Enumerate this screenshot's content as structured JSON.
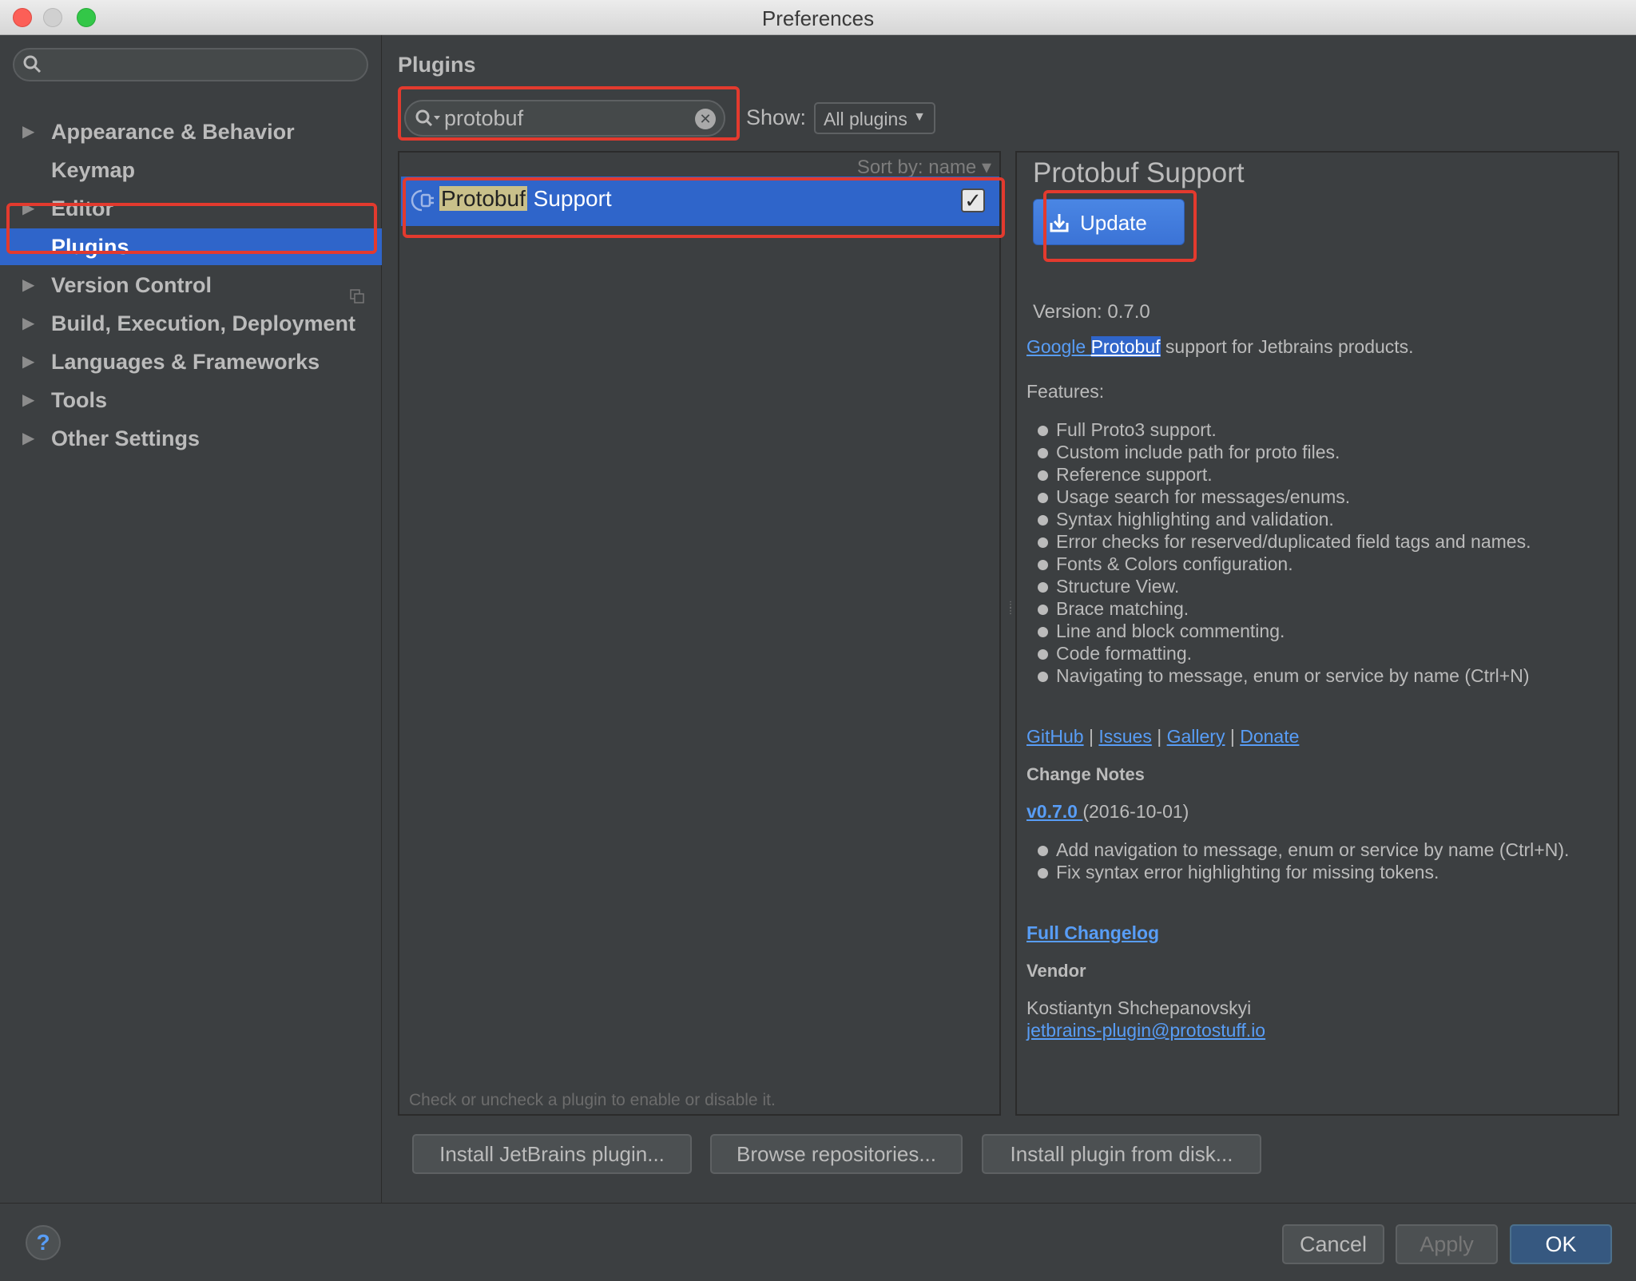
{
  "window": {
    "title": "Preferences"
  },
  "sidebar": {
    "search_placeholder": "",
    "items": [
      {
        "label": "Appearance & Behavior",
        "expandable": true
      },
      {
        "label": "Keymap",
        "expandable": false
      },
      {
        "label": "Editor",
        "expandable": true
      },
      {
        "label": "Plugins",
        "expandable": false,
        "selected": true
      },
      {
        "label": "Version Control",
        "expandable": true
      },
      {
        "label": "Build, Execution, Deployment",
        "expandable": true
      },
      {
        "label": "Languages & Frameworks",
        "expandable": true
      },
      {
        "label": "Tools",
        "expandable": true
      },
      {
        "label": "Other Settings",
        "expandable": true
      }
    ]
  },
  "plugins": {
    "title": "Plugins",
    "search_value": "protobuf",
    "show_label": "Show:",
    "show_value": "All plugins",
    "sort_by": "Sort by: name",
    "list": [
      {
        "name_highlight": "Protobuf",
        "name_rest": " Support",
        "enabled": true
      }
    ],
    "hint": "Check or uncheck a plugin to enable or disable it.",
    "buttons": {
      "install_jetbrains": "Install JetBrains plugin...",
      "browse": "Browse repositories...",
      "install_disk": "Install plugin from disk..."
    }
  },
  "detail": {
    "title": "Protobuf Support",
    "update_label": "Update",
    "version": "Version: 0.7.0",
    "desc_link1": "Google ",
    "desc_link2": "Protobuf",
    "desc_rest": " support for Jetbrains products.",
    "features_heading": "Features:",
    "features": [
      "Full Proto3 support.",
      "Custom include path for proto files.",
      "Reference support.",
      "Usage search for messages/enums.",
      "Syntax highlighting and validation.",
      "Error checks for reserved/duplicated field tags and names.",
      "Fonts & Colors configuration.",
      "Structure View.",
      "Brace matching.",
      "Line and block commenting.",
      "Code formatting.",
      "Navigating to message, enum or service by name (Ctrl+N)"
    ],
    "links": [
      "GitHub",
      "Issues",
      "Gallery",
      "Donate"
    ],
    "link_sep": " | ",
    "change_notes_heading": "Change Notes",
    "change_version": "v0.7.0 ",
    "change_date": "(2016-10-01)",
    "changes": [
      "Add navigation to message, enum or service by name (Ctrl+N).",
      "Fix syntax error highlighting for missing tokens."
    ],
    "full_changelog": "Full Changelog ",
    "vendor_heading": "Vendor",
    "vendor_name": "Kostiantyn Shchepanovskyi",
    "vendor_email": "jetbrains-plugin@protostuff.io"
  },
  "footer": {
    "help": "?",
    "cancel": "Cancel",
    "apply": "Apply",
    "ok": "OK"
  },
  "colors": {
    "selection": "#2f65ca",
    "link": "#589df6",
    "annotation": "#e33a2e",
    "background": "#3c3f41"
  }
}
